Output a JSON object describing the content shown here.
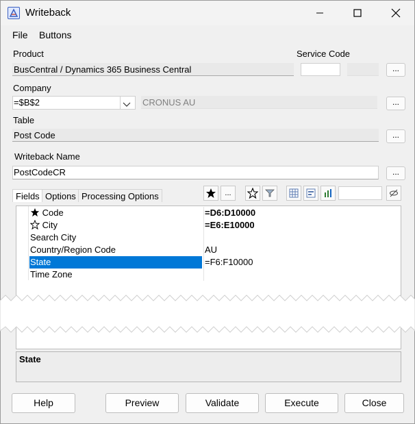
{
  "window": {
    "title": "Writeback"
  },
  "menu": [
    "File",
    "Buttons"
  ],
  "product": {
    "label": "Product",
    "value": "BusCentral / Dynamics 365 Business Central"
  },
  "service_code": {
    "label": "Service Code"
  },
  "company": {
    "label": "Company",
    "value": "=$B$2",
    "description": "CRONUS AU"
  },
  "table": {
    "label": "Table",
    "value": "Post Code"
  },
  "writeback_name": {
    "label": "Writeback Name",
    "value": "PostCodeCR"
  },
  "ellipsis": "...",
  "tabs": [
    "Fields",
    "Options",
    "Processing Options"
  ],
  "fields": [
    {
      "name": "Code",
      "value": "=D6:D10000",
      "marker": "key-filled",
      "bold": true
    },
    {
      "name": "City",
      "value": "=E6:E10000",
      "marker": "key-outline",
      "bold": true
    },
    {
      "name": "Search City",
      "value": ""
    },
    {
      "name": "Country/Region Code",
      "value": "AU"
    },
    {
      "name": "State",
      "value": "=F6:F10000",
      "selected": true
    },
    {
      "name": "Time Zone",
      "value": ""
    }
  ],
  "description": "State",
  "buttons": {
    "help": "Help",
    "preview": "Preview",
    "validate": "Validate",
    "execute": "Execute",
    "close": "Close"
  },
  "colors": {
    "selection": "#0078d7"
  }
}
